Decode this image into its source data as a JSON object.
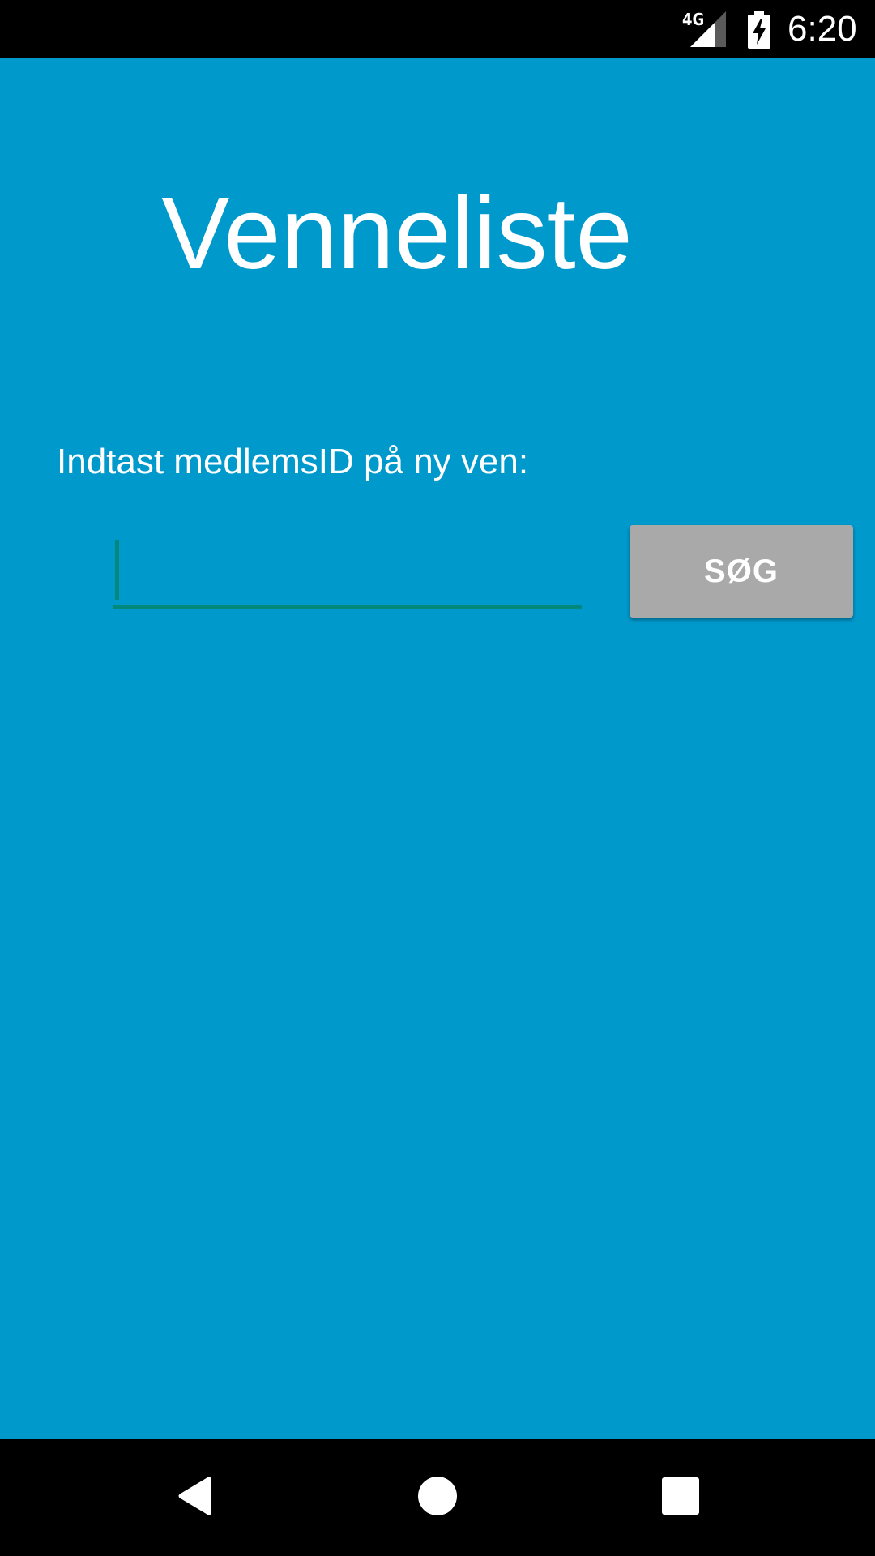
{
  "status_bar": {
    "network_label": "4G",
    "time": "6:20",
    "icons": [
      "signal-icon",
      "battery-charging-icon"
    ]
  },
  "app": {
    "title": "Venneliste",
    "prompt_label": "Indtast medlemsID på ny ven:",
    "member_id_input": {
      "value": "",
      "placeholder": ""
    },
    "search_button_label": "SØG"
  },
  "nav_bar": {
    "icons": [
      "back-icon",
      "home-icon",
      "recent-apps-icon"
    ]
  },
  "colors": {
    "background": "#0099CC",
    "input_underline": "#00897B",
    "button": "#A9A9A9",
    "text": "#FFFFFF",
    "system_bars": "#000000"
  }
}
